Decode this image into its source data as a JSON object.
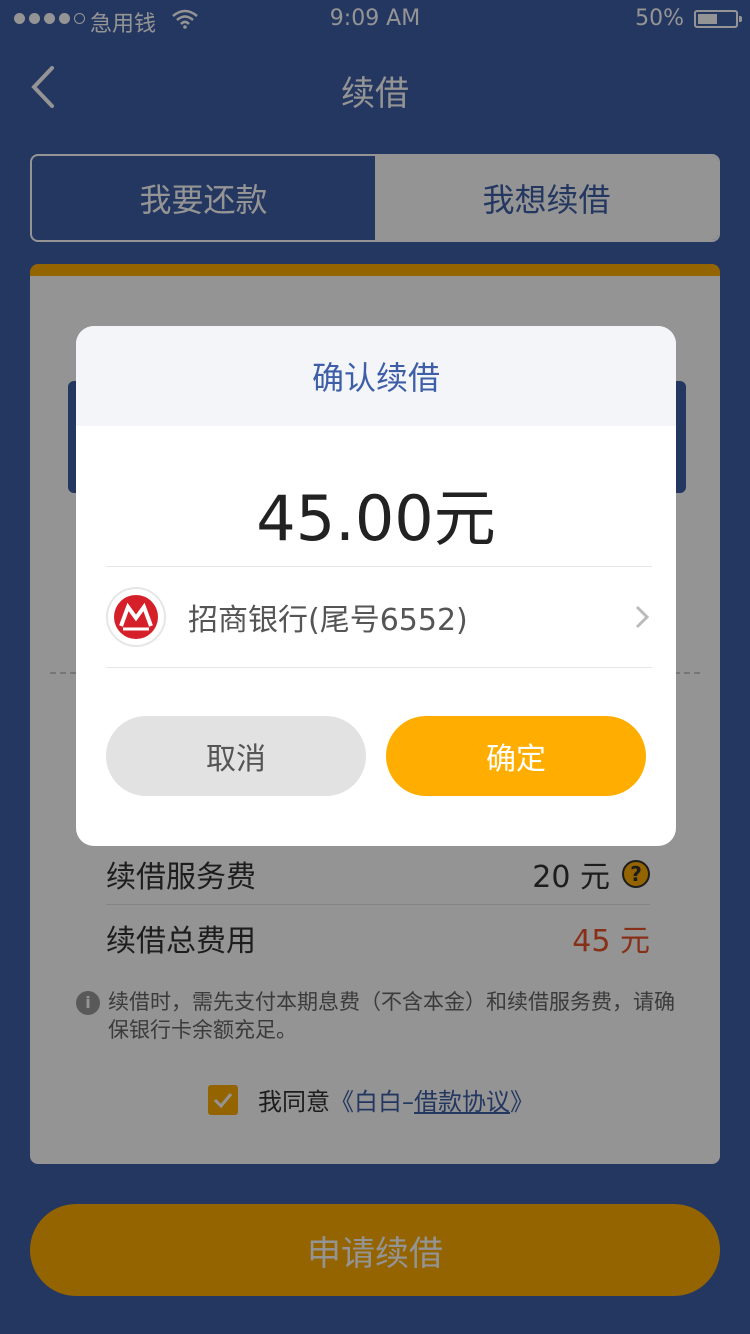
{
  "status_bar": {
    "carrier": "急用钱",
    "time": "9:09 AM",
    "battery": "50%"
  },
  "nav": {
    "title": "续借"
  },
  "tabs": [
    {
      "label": "我要还款",
      "active": false
    },
    {
      "label": "我想续借",
      "active": true
    }
  ],
  "card": {
    "renewal_fee_label": "续借服务费",
    "renewal_fee_value": "20 元",
    "total_fee_label": "续借总费用",
    "total_fee_value": "45 元",
    "note": "续借时，需先支付本期息费（不含本金）和续借服务费，请确保银行卡余额充足。",
    "agree_prefix": "我同意",
    "agree_link_open": "《白白–",
    "agree_link_underlined": "借款协议",
    "agree_link_close": "》"
  },
  "apply_button": "申请续借",
  "dialog": {
    "title": "确认续借",
    "amount": "45.00元",
    "bank": "招商银行(尾号6552)",
    "cancel": "取消",
    "confirm": "确定"
  },
  "colors": {
    "primary": "#3e5fa8",
    "accent": "#ffad00",
    "danger": "#e8532a"
  }
}
